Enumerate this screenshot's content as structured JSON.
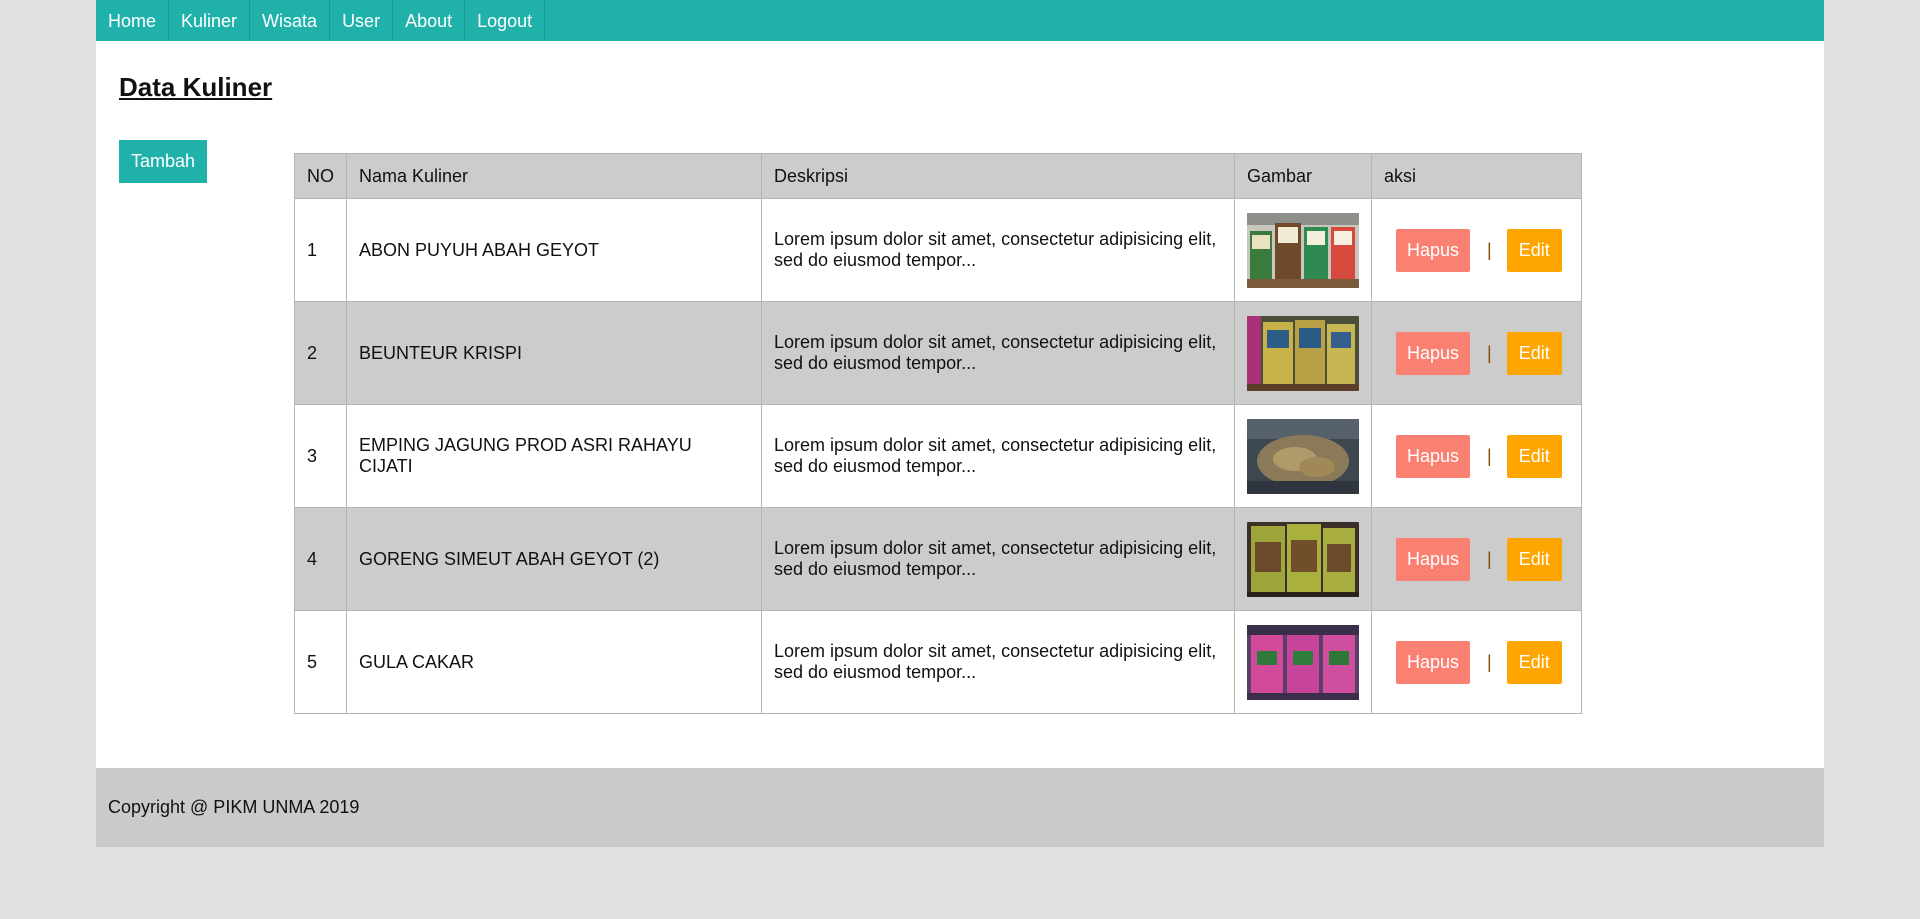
{
  "nav": {
    "items": [
      {
        "label": "Home"
      },
      {
        "label": "Kuliner"
      },
      {
        "label": "Wisata"
      },
      {
        "label": "User"
      },
      {
        "label": "About"
      },
      {
        "label": "Logout"
      }
    ]
  },
  "page": {
    "title": "Data Kuliner",
    "add_label": "Tambah"
  },
  "table": {
    "headers": {
      "no": "NO",
      "nama": "Nama Kuliner",
      "deskripsi": "Deskripsi",
      "gambar": "Gambar",
      "aksi": "aksi"
    },
    "rows": [
      {
        "no": "1",
        "nama": "ABON PUYUH ABAH GEYOT",
        "deskripsi": "Lorem ipsum dolor sit amet, consectetur adipisicing elit, sed do eiusmod tempor...",
        "hapus": "Hapus",
        "sep": "|",
        "edit": "Edit"
      },
      {
        "no": "2",
        "nama": "BEUNTEUR KRISPI",
        "deskripsi": "Lorem ipsum dolor sit amet, consectetur adipisicing elit, sed do eiusmod tempor...",
        "hapus": "Hapus",
        "sep": "|",
        "edit": "Edit"
      },
      {
        "no": "3",
        "nama": "EMPING JAGUNG PROD ASRI RAHAYU CIJATI",
        "deskripsi": "Lorem ipsum dolor sit amet, consectetur adipisicing elit, sed do eiusmod tempor...",
        "hapus": "Hapus",
        "sep": "|",
        "edit": "Edit"
      },
      {
        "no": "4",
        "nama": "GORENG SIMEUT ABAH GEYOT (2)",
        "deskripsi": "Lorem ipsum dolor sit amet, consectetur adipisicing elit, sed do eiusmod tempor...",
        "hapus": "Hapus",
        "sep": "|",
        "edit": "Edit"
      },
      {
        "no": "5",
        "nama": "GULA CAKAR",
        "deskripsi": "Lorem ipsum dolor sit amet, consectetur adipisicing elit, sed do eiusmod tempor...",
        "hapus": "Hapus",
        "sep": "|",
        "edit": "Edit"
      }
    ]
  },
  "footer": {
    "text": "Copyright @ PIKM UNMA 2019"
  },
  "colors": {
    "navbar": "#20b2aa",
    "hapus": "#fa8072",
    "edit": "#ffa500",
    "row_alt": "#cccccc",
    "footer": "#cacaca",
    "outer_bg": "#e0e0e0"
  }
}
